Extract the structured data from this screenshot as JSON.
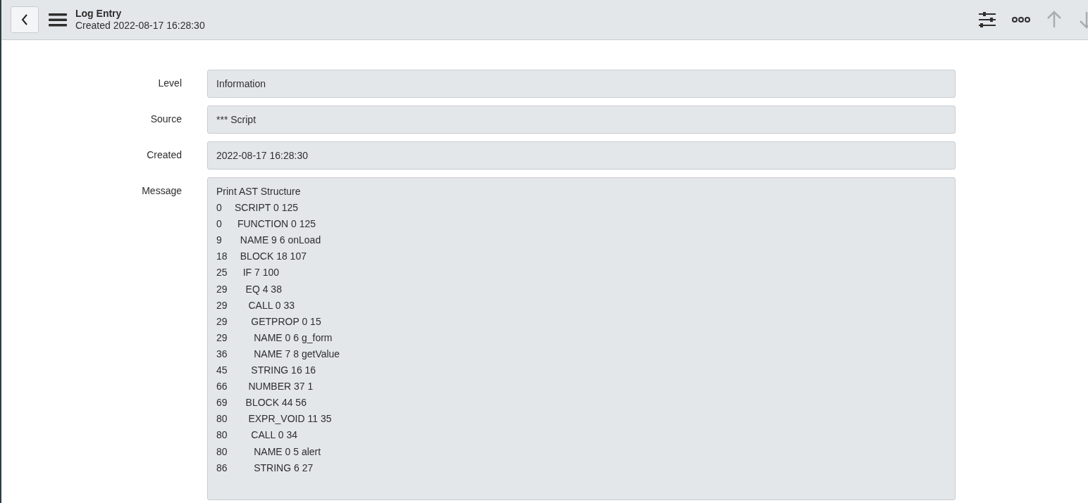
{
  "header": {
    "title": "Log Entry",
    "subtitle": "Created 2022-08-17 16:28:30",
    "up_disabled": true,
    "down_disabled": true
  },
  "fields": [
    {
      "label": "Level",
      "value": "Information",
      "kind": "input"
    },
    {
      "label": "Source",
      "value": "*** Script",
      "kind": "input"
    },
    {
      "label": "Created",
      "value": "2022-08-17 16:28:30",
      "kind": "input"
    },
    {
      "label": "Message",
      "value": "Print AST Structure\n0\tSCRIPT 0 125\n0\t FUNCTION 0 125\n9\t  NAME 9 6 onLoad\n18\t  BLOCK 18 107\n25\t   IF 7 100\n29\t    EQ 4 38\n29\t     CALL 0 33\n29\t      GETPROP 0 15\n29\t       NAME 0 6 g_form\n36\t       NAME 7 8 getValue\n45\t      STRING 16 16\n66\t     NUMBER 37 1\n69\t    BLOCK 44 56\n80\t     EXPR_VOID 11 35\n80\t      CALL 0 34\n80\t       NAME 0 5 alert\n86\t       STRING 6 27",
      "kind": "textarea"
    }
  ]
}
